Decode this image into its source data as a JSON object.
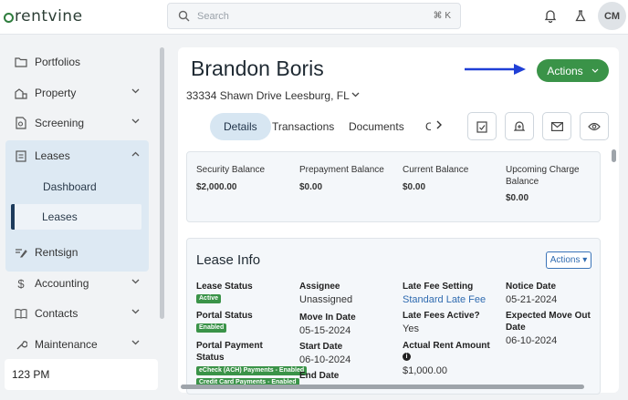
{
  "brand": {
    "logo_text": "rentvine"
  },
  "search": {
    "placeholder": "Search",
    "shortcut": "⌘ K"
  },
  "user": {
    "initials": "CM"
  },
  "sidebar": {
    "items": [
      {
        "label": "Portfolios"
      },
      {
        "label": "Property"
      },
      {
        "label": "Screening"
      },
      {
        "label": "Leases"
      },
      {
        "label": "Rentsign"
      },
      {
        "label": "Accounting"
      },
      {
        "label": "Contacts"
      },
      {
        "label": "Maintenance"
      }
    ],
    "leases_sub": [
      {
        "label": "Dashboard"
      },
      {
        "label": "Leases"
      }
    ],
    "clock": "123 PM"
  },
  "main": {
    "title": "Brandon Boris",
    "address": "33334 Shawn Drive Leesburg, FL",
    "actions_label": "Actions",
    "tabs": [
      {
        "label": "Details"
      },
      {
        "label": "Transactions"
      },
      {
        "label": "Documents"
      },
      {
        "label": "C"
      }
    ],
    "balances": [
      {
        "label": "Security Balance",
        "value": "$2,000.00"
      },
      {
        "label": "Prepayment Balance",
        "value": "$0.00"
      },
      {
        "label": "Current Balance",
        "value": "$0.00"
      },
      {
        "label": "Upcoming Charge Balance",
        "value": "$0.00"
      }
    ],
    "lease_info": {
      "title": "Lease Info",
      "actions_label": "Actions ▾",
      "lease_status_label": "Lease Status",
      "lease_status_badge": "Active",
      "portal_status_label": "Portal Status",
      "portal_status_badge": "Enabled",
      "portal_payment_label": "Portal Payment Status",
      "portal_payment_badge_1": "eCheck (ACH) Payments - Enabled",
      "portal_payment_badge_2": "Credit Card Payments - Enabled",
      "assignee_label": "Assignee",
      "assignee_value": "Unassigned",
      "move_in_label": "Move In Date",
      "move_in_value": "05-15-2024",
      "start_label": "Start Date",
      "start_value": "06-10-2024",
      "end_label": "End Date",
      "late_fee_setting_label": "Late Fee Setting",
      "late_fee_setting_value": "Standard Late Fee",
      "late_fees_active_label": "Late Fees Active?",
      "late_fees_active_value": "Yes",
      "actual_rent_label": "Actual Rent Amount",
      "actual_rent_value": "$1,000.00",
      "notice_label": "Notice Date",
      "notice_value": "05-21-2024",
      "expected_move_out_label": "Expected Move Out Date",
      "expected_move_out_value": "06-10-2024"
    }
  },
  "colors": {
    "accent_green": "#3a9348",
    "link_blue": "#2f6bb0",
    "arrow_blue": "#1f3fd6",
    "nav_active_bg": "#dde9f3"
  }
}
